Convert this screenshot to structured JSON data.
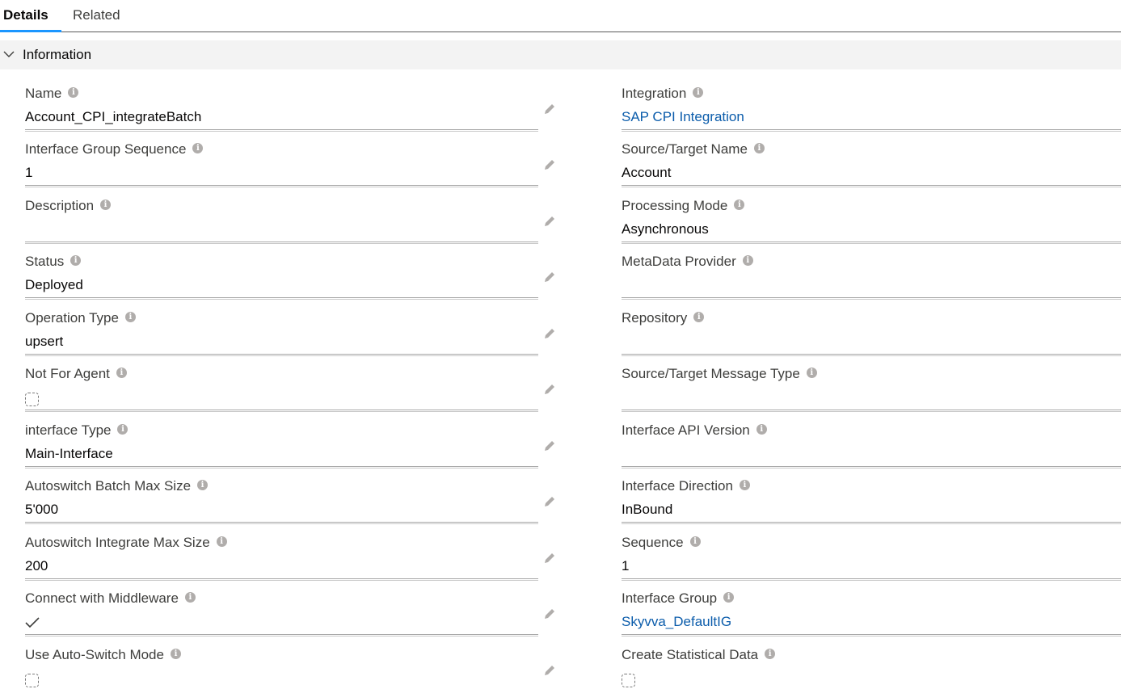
{
  "tabs": [
    {
      "label": "Details"
    },
    {
      "label": "Related"
    }
  ],
  "section": {
    "title": "Information"
  },
  "left_fields": [
    {
      "label": "Name",
      "value": "Account_CPI_integrateBatch"
    },
    {
      "label": "Interface Group Sequence",
      "value": "1"
    },
    {
      "label": "Description",
      "value": ""
    },
    {
      "label": "Status",
      "value": "Deployed"
    },
    {
      "label": "Operation Type",
      "value": "upsert"
    },
    {
      "label": "Not For Agent",
      "checked": false
    },
    {
      "label": "interface Type",
      "value": "Main-Interface"
    },
    {
      "label": "Autoswitch Batch Max Size",
      "value": "5'000"
    },
    {
      "label": "Autoswitch Integrate Max Size",
      "value": "200"
    },
    {
      "label": "Connect with Middleware",
      "checked": true
    },
    {
      "label": "Use Auto-Switch Mode",
      "checked": false
    }
  ],
  "right_fields": [
    {
      "label": "Integration",
      "value": "SAP CPI Integration"
    },
    {
      "label": "Source/Target Name",
      "value": "Account"
    },
    {
      "label": "Processing Mode",
      "value": "Asynchronous"
    },
    {
      "label": "MetaData Provider",
      "value": ""
    },
    {
      "label": "Repository",
      "value": ""
    },
    {
      "label": "Source/Target Message Type",
      "value": ""
    },
    {
      "label": "Interface API Version",
      "value": ""
    },
    {
      "label": "Interface Direction",
      "value": "InBound"
    },
    {
      "label": "Sequence",
      "value": "1"
    },
    {
      "label": "Interface Group",
      "value": "Skyvva_DefaultIG"
    },
    {
      "label": "Create Statistical Data",
      "checked": false
    }
  ],
  "colors": {
    "link": "#0b5cab",
    "active_tab": "#1b96ff",
    "section_bg": "#f3f3f3"
  },
  "icons": {
    "info": "info-icon",
    "edit": "pencil-icon",
    "expand": "chevron-down-icon",
    "check": "check-icon"
  }
}
